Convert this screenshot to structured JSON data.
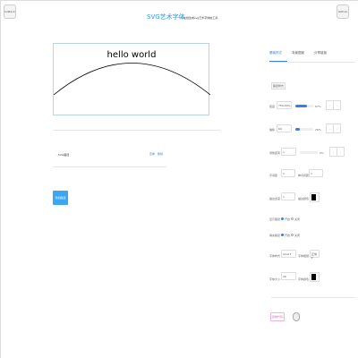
{
  "header": {
    "goback": "GoBack",
    "title": "SVG艺术字体",
    "subtitle": "一个在线生成svg艺术字体的工具",
    "github": "Github"
  },
  "canvas": {
    "text": "hello world"
  },
  "paths": {
    "items": [
      {
        "label": "SVG路径",
        "view": "查看",
        "delete": "删除"
      }
    ],
    "add_button": "添加路径"
  },
  "tabs": [
    "基础样式",
    "背景图案",
    "分享链接"
  ],
  "panel": {
    "section": "路径样式",
    "arc": {
      "label": "弧度",
      "value": "750.00%",
      "percent": "67%",
      "fill": 0.67
    },
    "offset": {
      "label": "偏移",
      "value": "64",
      "percent": "26%",
      "fill": 0.26
    },
    "distance": {
      "label": "调整距离",
      "value": "1",
      "percent": "0%",
      "fill": 0
    },
    "letter_spacing": {
      "label": "字间距",
      "value": "1"
    },
    "word_spacing": {
      "label": "单词间距",
      "value": "1"
    },
    "stroke_width": {
      "label": "描边宽度",
      "value": "1"
    },
    "stroke_color": {
      "label": "描边颜色",
      "value": "#000000"
    },
    "show_path": {
      "label": "显示路径",
      "on": "开启",
      "off": "关闭"
    },
    "fill_path": {
      "label": "填充路径",
      "on": "开启",
      "off": "关闭"
    },
    "font_family": {
      "label": "字体样式",
      "value": "Arial"
    },
    "font_weight": {
      "label": "字体粗细",
      "value": "正常"
    },
    "font_size": {
      "label": "字体大小",
      "value": "20"
    },
    "font_color": {
      "label": "字体颜色",
      "value": "#000000"
    },
    "copy_button": "复制代码"
  }
}
